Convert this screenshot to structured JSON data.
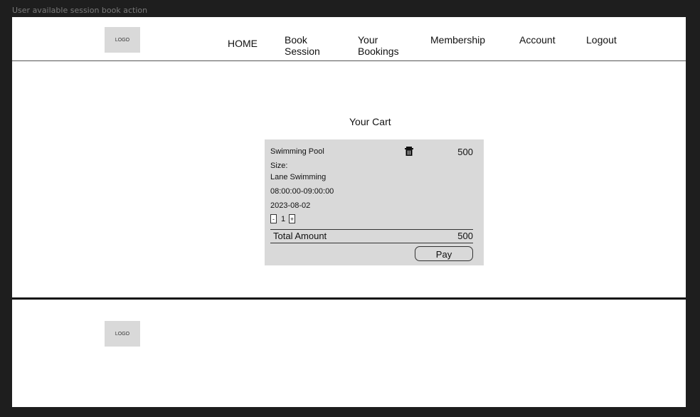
{
  "frame_label": "User available session book action",
  "header": {
    "logo_text": "LOGO",
    "nav": [
      {
        "label": "HOME"
      },
      {
        "label": "Book\nSession"
      },
      {
        "label": "Your\nBookings"
      },
      {
        "label": "Membership"
      },
      {
        "label": "Account"
      },
      {
        "label": "Logout"
      }
    ]
  },
  "cart": {
    "title": "Your Cart",
    "item": {
      "name": "Swimming Pool",
      "size_label": "Size:",
      "size_value": "Lane Swimming",
      "time": "08:00:00-09:00:00",
      "date": "2023-08-02",
      "price": "500",
      "quantity": "1",
      "minus": "-",
      "plus": "+"
    },
    "total_label": "Total Amount",
    "total_value": "500",
    "pay_label": "Pay"
  },
  "footer": {
    "logo_text": "LOGO"
  },
  "colors": {
    "background": "#1e1e1e",
    "frame": "#ffffff",
    "placeholder": "#d9d9d9"
  }
}
